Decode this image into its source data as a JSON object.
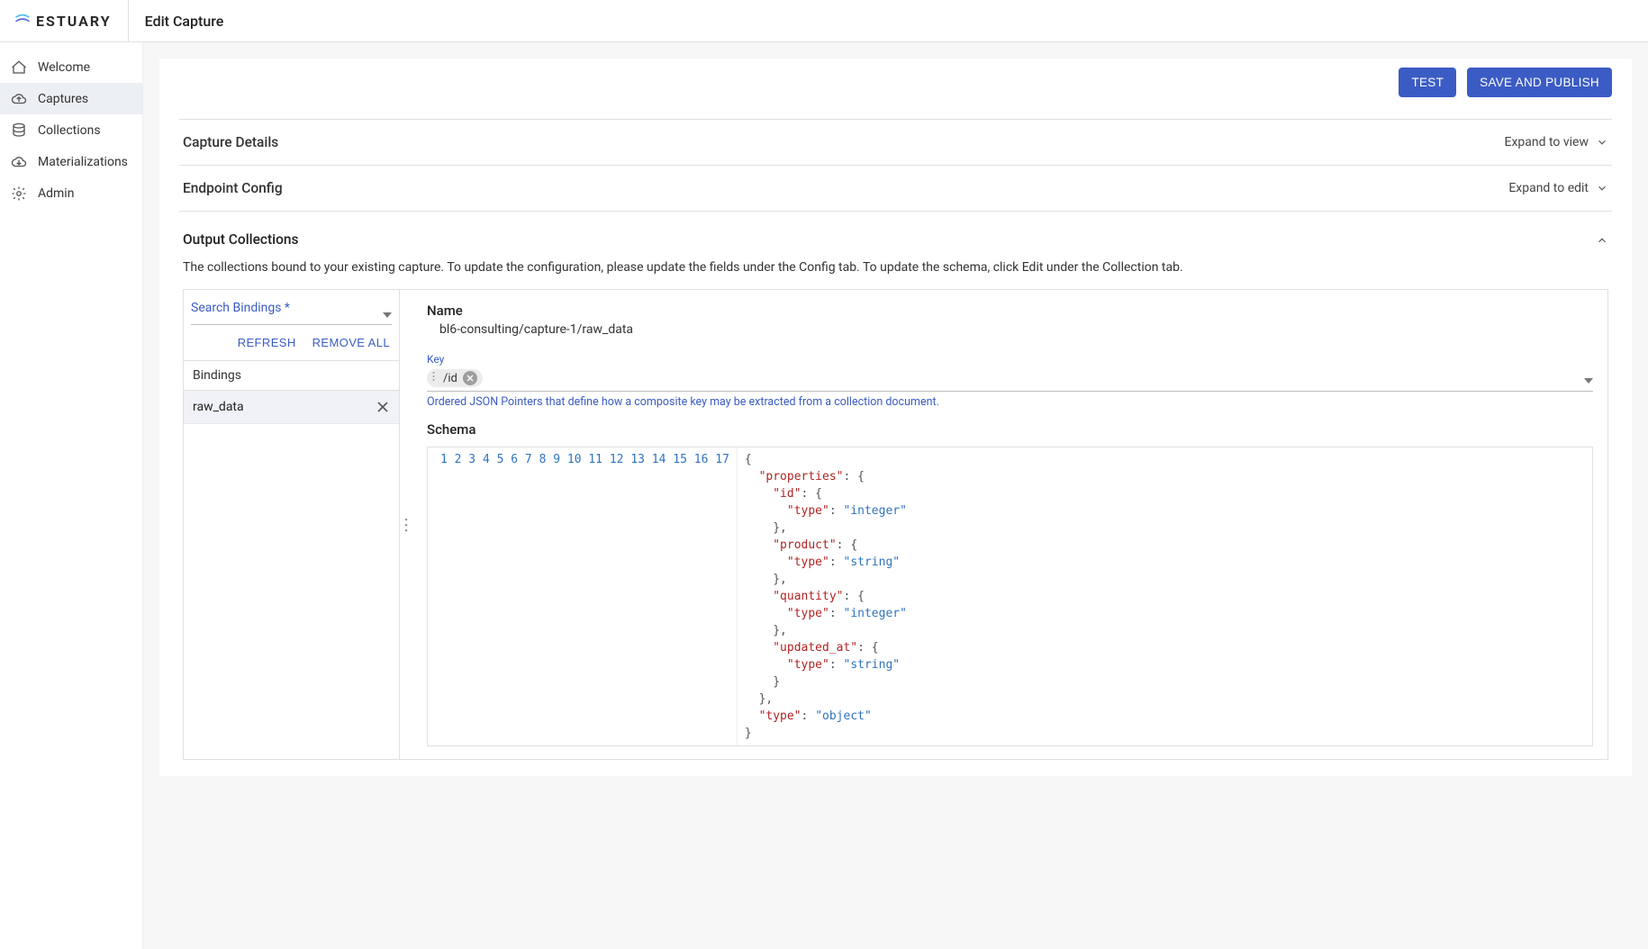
{
  "brand": "ESTUARY",
  "page_title": "Edit Capture",
  "sidebar": {
    "items": [
      {
        "label": "Welcome",
        "active": false,
        "icon": "home-icon"
      },
      {
        "label": "Captures",
        "active": true,
        "icon": "cloud-upload-icon"
      },
      {
        "label": "Collections",
        "active": false,
        "icon": "database-icon"
      },
      {
        "label": "Materializations",
        "active": false,
        "icon": "cloud-download-icon"
      },
      {
        "label": "Admin",
        "active": false,
        "icon": "gear-icon"
      }
    ]
  },
  "toolbar": {
    "test_label": "TEST",
    "save_label": "SAVE AND PUBLISH"
  },
  "sections": {
    "capture_details": {
      "title": "Capture Details",
      "hint": "Expand to view"
    },
    "endpoint_config": {
      "title": "Endpoint Config",
      "hint": "Expand to edit"
    }
  },
  "output_collections": {
    "title": "Output Collections",
    "description": "The collections bound to your existing capture. To update the configuration, please update the fields under the Config tab. To update the schema, click Edit under the Collection tab.",
    "search_label": "Search Bindings *",
    "refresh_label": "REFRESH",
    "remove_all_label": "REMOVE ALL",
    "bindings_header": "Bindings",
    "bindings": [
      {
        "label": "raw_data"
      }
    ],
    "detail": {
      "name_label": "Name",
      "name_value": "bl6-consulting/capture-1/raw_data",
      "key_label": "Key",
      "key_chip": "/id",
      "key_help": "Ordered JSON Pointers that define how a composite key may be extracted from a collection document.",
      "schema_label": "Schema",
      "schema_lines": [
        {
          "n": 1,
          "tokens": [
            {
              "t": "punc",
              "v": "{"
            }
          ]
        },
        {
          "n": 2,
          "tokens": [
            {
              "t": "indent",
              "v": "  "
            },
            {
              "t": "key",
              "v": "\"properties\""
            },
            {
              "t": "punc",
              "v": ": {"
            }
          ]
        },
        {
          "n": 3,
          "tokens": [
            {
              "t": "indent",
              "v": "    "
            },
            {
              "t": "key",
              "v": "\"id\""
            },
            {
              "t": "punc",
              "v": ": {"
            }
          ]
        },
        {
          "n": 4,
          "tokens": [
            {
              "t": "indent",
              "v": "      "
            },
            {
              "t": "key",
              "v": "\"type\""
            },
            {
              "t": "punc",
              "v": ": "
            },
            {
              "t": "str",
              "v": "\"integer\""
            }
          ]
        },
        {
          "n": 5,
          "tokens": [
            {
              "t": "indent",
              "v": "    "
            },
            {
              "t": "punc",
              "v": "},"
            }
          ]
        },
        {
          "n": 6,
          "tokens": [
            {
              "t": "indent",
              "v": "    "
            },
            {
              "t": "key",
              "v": "\"product\""
            },
            {
              "t": "punc",
              "v": ": {"
            }
          ]
        },
        {
          "n": 7,
          "tokens": [
            {
              "t": "indent",
              "v": "      "
            },
            {
              "t": "key",
              "v": "\"type\""
            },
            {
              "t": "punc",
              "v": ": "
            },
            {
              "t": "str",
              "v": "\"string\""
            }
          ]
        },
        {
          "n": 8,
          "tokens": [
            {
              "t": "indent",
              "v": "    "
            },
            {
              "t": "punc",
              "v": "},"
            }
          ]
        },
        {
          "n": 9,
          "tokens": [
            {
              "t": "indent",
              "v": "    "
            },
            {
              "t": "key",
              "v": "\"quantity\""
            },
            {
              "t": "punc",
              "v": ": {"
            }
          ]
        },
        {
          "n": 10,
          "tokens": [
            {
              "t": "indent",
              "v": "      "
            },
            {
              "t": "key",
              "v": "\"type\""
            },
            {
              "t": "punc",
              "v": ": "
            },
            {
              "t": "str",
              "v": "\"integer\""
            }
          ]
        },
        {
          "n": 11,
          "tokens": [
            {
              "t": "indent",
              "v": "    "
            },
            {
              "t": "punc",
              "v": "},"
            }
          ]
        },
        {
          "n": 12,
          "tokens": [
            {
              "t": "indent",
              "v": "    "
            },
            {
              "t": "key",
              "v": "\"updated_at\""
            },
            {
              "t": "punc",
              "v": ": {"
            }
          ]
        },
        {
          "n": 13,
          "tokens": [
            {
              "t": "indent",
              "v": "      "
            },
            {
              "t": "key",
              "v": "\"type\""
            },
            {
              "t": "punc",
              "v": ": "
            },
            {
              "t": "str",
              "v": "\"string\""
            }
          ]
        },
        {
          "n": 14,
          "tokens": [
            {
              "t": "indent",
              "v": "    "
            },
            {
              "t": "punc",
              "v": "}"
            }
          ]
        },
        {
          "n": 15,
          "tokens": [
            {
              "t": "indent",
              "v": "  "
            },
            {
              "t": "punc",
              "v": "},"
            }
          ]
        },
        {
          "n": 16,
          "tokens": [
            {
              "t": "indent",
              "v": "  "
            },
            {
              "t": "key",
              "v": "\"type\""
            },
            {
              "t": "punc",
              "v": ": "
            },
            {
              "t": "str",
              "v": "\"object\""
            }
          ]
        },
        {
          "n": 17,
          "tokens": [
            {
              "t": "punc",
              "v": "}"
            }
          ]
        }
      ]
    }
  }
}
